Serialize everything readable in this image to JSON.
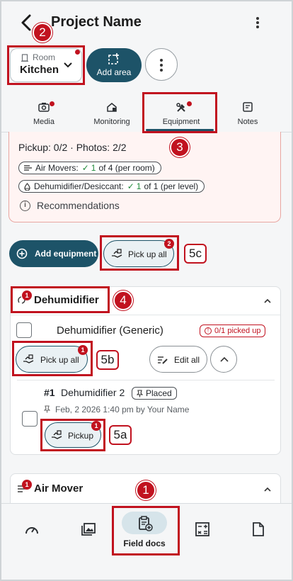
{
  "header": {
    "title": "Project Name"
  },
  "area": {
    "room_label": "Room",
    "room_value": "Kitchen",
    "add_area_label": "Add area"
  },
  "tabs": [
    {
      "label": "Media"
    },
    {
      "label": "Monitoring"
    },
    {
      "label": "Equipment"
    },
    {
      "label": "Notes"
    }
  ],
  "summary": {
    "pickup_line": "Pickup: 0/2 · Photos: 2/2",
    "air_movers_label": "Air Movers:",
    "air_movers_count": "1",
    "air_movers_rest": "of 4 (per room)",
    "dehu_label": "Dehumidifier/Desiccant:",
    "dehu_count": "1",
    "dehu_rest": "of 1 (per level)",
    "recommendations": "Recommendations"
  },
  "actions": {
    "add_equipment": "Add equipment",
    "pick_up_all": "Pick up all",
    "pick_up_all_badge": "2"
  },
  "dehumidifier": {
    "title": "Dehumidifier",
    "badge": "1",
    "generic_name": "Dehumidifier (Generic)",
    "picked_status": "0/1 picked up",
    "pick_up_all": "Pick up all",
    "pick_up_all_badge": "1",
    "edit_all": "Edit all",
    "item_number": "#1",
    "item_name": "Dehumidifier 2",
    "placed_label": "Placed",
    "placed_meta": "Feb, 2 2026 1:40 pm by Your Name",
    "pickup_label": "Pickup",
    "pickup_badge": "1"
  },
  "air_mover": {
    "title": "Air Mover",
    "badge": "1"
  },
  "bottom_nav": {
    "active_label": "Field docs"
  },
  "annotations": {
    "m1": "1",
    "m2": "2",
    "m3": "3",
    "m4": "4",
    "l5a": "5a",
    "l5b": "5b",
    "l5c": "5c"
  },
  "colors": {
    "primary": "#1d5368",
    "alert_red": "#c1121f",
    "success_green": "#1f8a3a",
    "warning_bg": "#fff4f3"
  }
}
